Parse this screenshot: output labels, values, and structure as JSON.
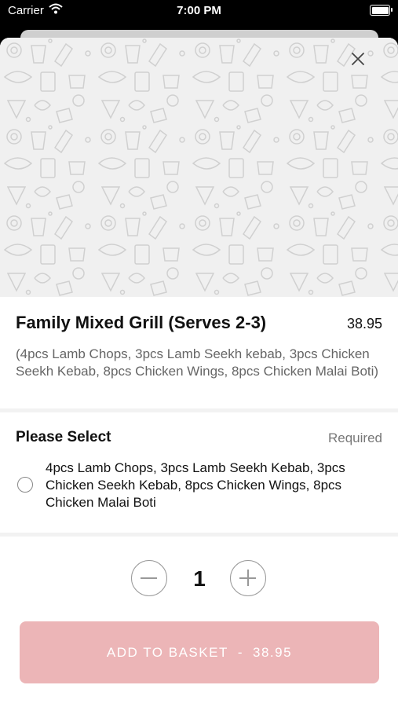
{
  "status_bar": {
    "carrier": "Carrier",
    "time": "7:00 PM"
  },
  "item": {
    "title": "Family Mixed Grill (Serves 2-3)",
    "price": "38.95",
    "description": "(4pcs Lamb Chops, 3pcs Lamb Seekh kebab, 3pcs Chicken Seekh Kebab, 8pcs Chicken Wings, 8pcs Chicken Malai Boti)"
  },
  "options_section": {
    "title": "Please Select",
    "required_label": "Required",
    "options": [
      {
        "label": "4pcs Lamb Chops, 3pcs Lamb Seekh Kebab, 3pcs Chicken Seekh Kebab, 8pcs Chicken Wings, 8pcs Chicken Malai Boti",
        "selected": false
      }
    ]
  },
  "quantity": {
    "value": "1"
  },
  "add_button": {
    "label": "ADD TO BASKET",
    "separator": "-",
    "price": "38.95"
  },
  "colors": {
    "accent": "#ecb5b7",
    "pattern_bg": "#f0f0f0",
    "pattern_stroke": "#d0d0d0"
  },
  "icons": {
    "close": "close-icon",
    "minus": "minus-icon",
    "plus": "plus-icon",
    "wifi": "wifi-icon",
    "battery": "battery-icon"
  }
}
